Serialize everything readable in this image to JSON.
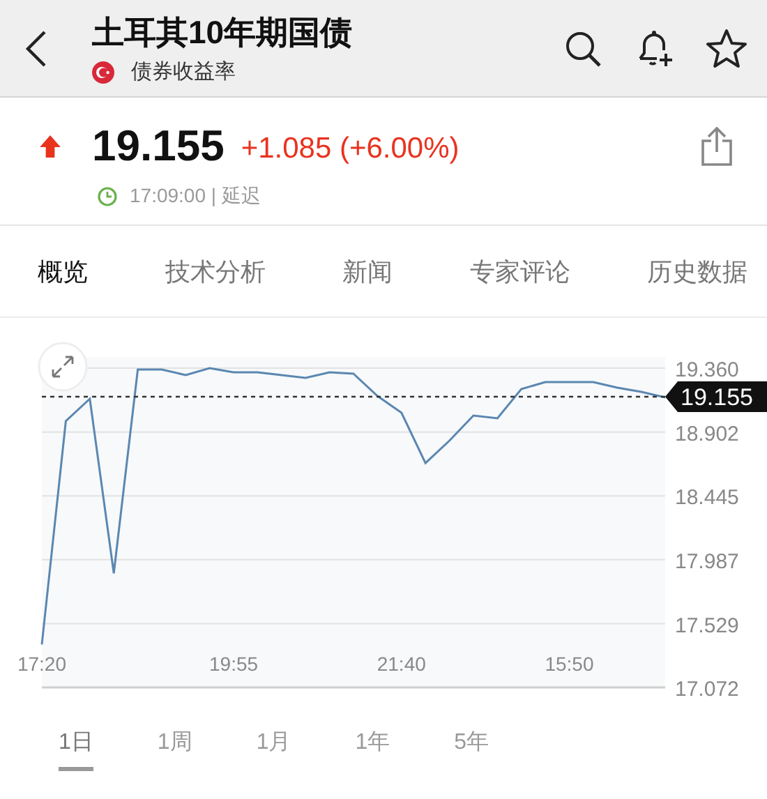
{
  "header": {
    "title": "土耳其10年期国债",
    "subtitle": "债券收益率"
  },
  "quote": {
    "up": true,
    "price": "19.155",
    "change": "+1.085 (+6.00%)",
    "time": "17:09:00 | 延迟"
  },
  "tabs": [
    {
      "label": "概览",
      "selected": true
    },
    {
      "label": "技术分析",
      "selected": false
    },
    {
      "label": "新闻",
      "selected": false
    },
    {
      "label": "专家评论",
      "selected": false
    },
    {
      "label": "历史数据",
      "selected": false
    }
  ],
  "chart": {
    "current_label": "19.155",
    "chart_data": {
      "type": "line",
      "categories": [
        "17:20",
        null,
        null,
        null,
        null,
        null,
        null,
        null,
        "19:55",
        null,
        null,
        null,
        null,
        null,
        null,
        "21:40",
        null,
        null,
        null,
        null,
        null,
        null,
        "15:50",
        null,
        null,
        null,
        null
      ],
      "yticks": [
        {
          "value": 19.36,
          "label": "19.360"
        },
        {
          "value": 18.902,
          "label": "18.902"
        },
        {
          "value": 18.445,
          "label": "18.445"
        },
        {
          "value": 17.987,
          "label": "17.987"
        },
        {
          "value": 17.529,
          "label": "17.529"
        },
        {
          "value": 17.072,
          "label": "17.072"
        }
      ],
      "ylim": [
        17.072,
        19.36
      ],
      "grid": true,
      "ref_lines": [
        {
          "axis": "y",
          "value": 19.155
        }
      ],
      "series": [
        {
          "color": "#5b87b0",
          "values": [
            17.38,
            18.98,
            19.14,
            17.89,
            19.35,
            19.35,
            19.31,
            19.36,
            19.33,
            19.33,
            19.31,
            19.29,
            19.33,
            19.32,
            19.16,
            19.04,
            18.68,
            18.84,
            19.02,
            19.0,
            19.21,
            19.26,
            19.26,
            19.26,
            19.22,
            19.19,
            19.15
          ]
        }
      ]
    }
  },
  "periods": [
    {
      "label": "1日",
      "selected": true
    },
    {
      "label": "1周",
      "selected": false
    },
    {
      "label": "1月",
      "selected": false
    },
    {
      "label": "1年",
      "selected": false
    },
    {
      "label": "5年",
      "selected": false
    }
  ]
}
